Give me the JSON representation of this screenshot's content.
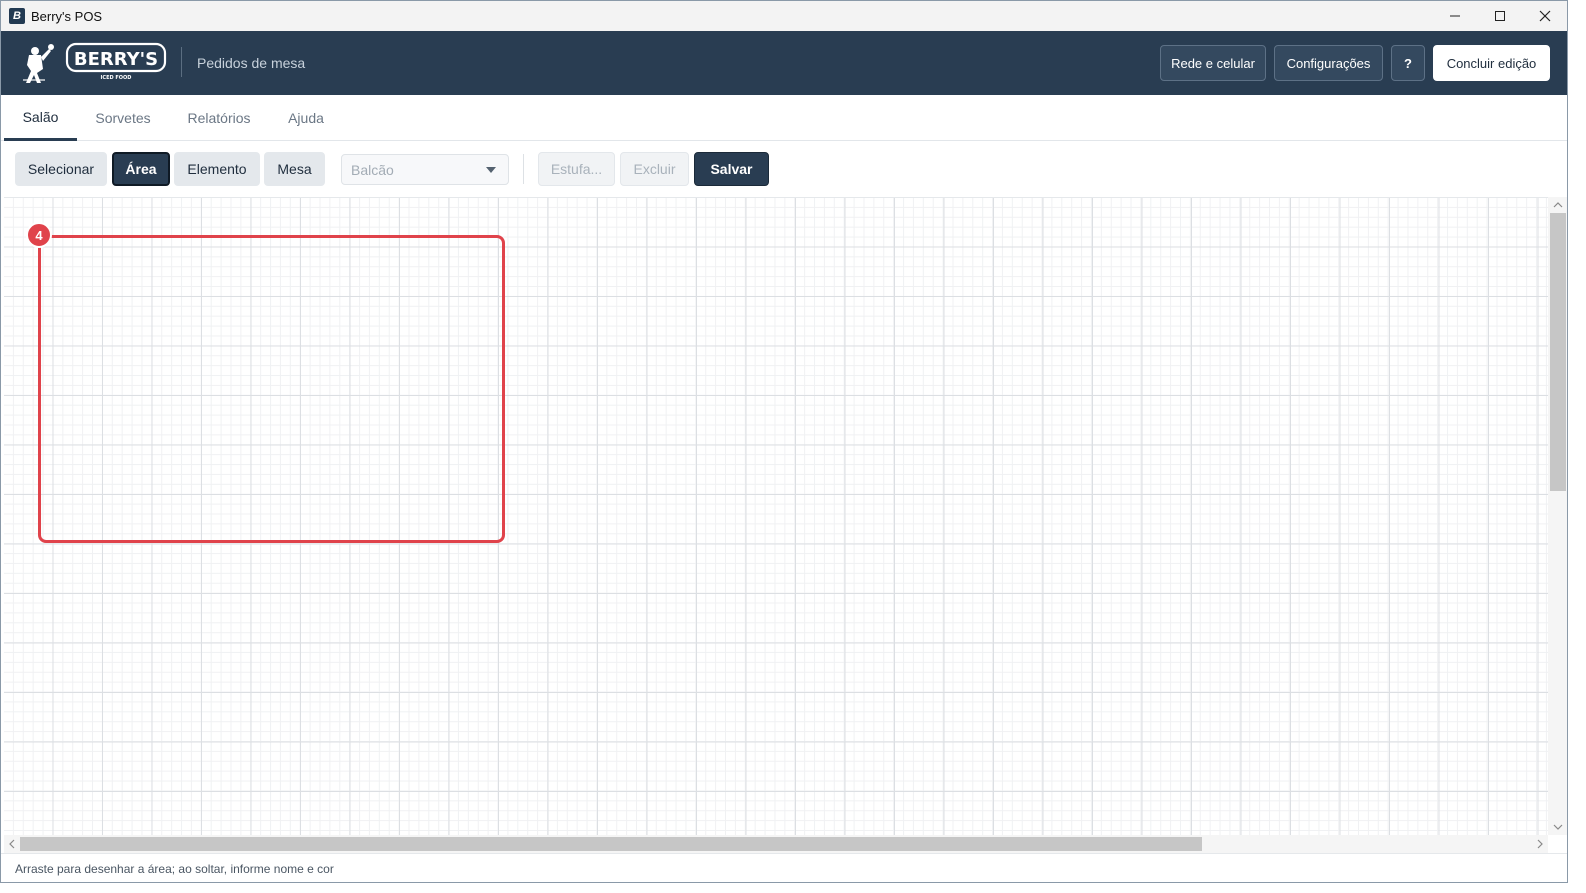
{
  "window": {
    "title": "Berry's POS",
    "app_icon_glyph": "B",
    "controls": {
      "minimize": "─",
      "maximize": "☐",
      "close": "✕"
    }
  },
  "header": {
    "logo_text": "BERRY'S",
    "logo_subtext": "ICED FOOD",
    "subtitle": "Pedidos de mesa",
    "buttons": {
      "network": "Rede e celular",
      "settings": "Configurações",
      "help": "?",
      "finish": "Concluir edição"
    }
  },
  "tabs": [
    {
      "label": "Salão",
      "active": true
    },
    {
      "label": "Sorvetes",
      "active": false
    },
    {
      "label": "Relatórios",
      "active": false
    },
    {
      "label": "Ajuda",
      "active": false
    }
  ],
  "toolbar": {
    "select_label": "Selecionar",
    "area_label": "Área",
    "element_label": "Elemento",
    "table_label": "Mesa",
    "dropdown_value": "Balcão",
    "estufa_label": "Estufa...",
    "delete_label": "Excluir",
    "save_label": "Salvar"
  },
  "canvas": {
    "area": {
      "badge": "4",
      "color": "#e0434b"
    }
  },
  "status": {
    "text": "Arraste para desenhar a área; ao soltar, informe nome e cor"
  },
  "colors": {
    "header_bg": "#293d52",
    "accent": "#293d52",
    "area_border": "#e0434b"
  }
}
